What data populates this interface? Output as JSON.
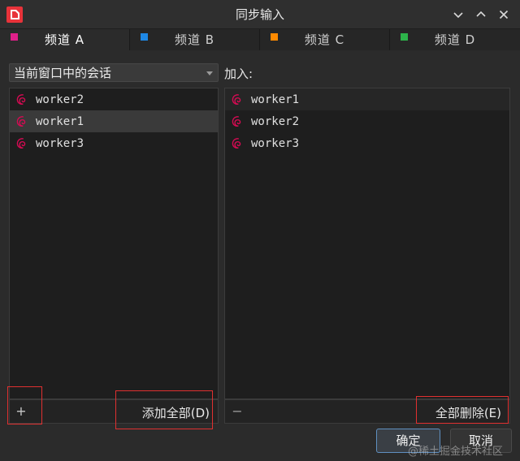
{
  "window": {
    "title": "同步输入",
    "icon": "app-logo-icon"
  },
  "tabs": [
    {
      "label": "频道 A",
      "color": "#e0208a",
      "active": true
    },
    {
      "label": "频道 B",
      "color": "#1e88e5",
      "active": false
    },
    {
      "label": "频道 C",
      "color": "#ff8a00",
      "active": false
    },
    {
      "label": "频道 D",
      "color": "#2db34a",
      "active": false
    }
  ],
  "left_panel": {
    "source_select": "当前窗口中的会话",
    "items": [
      {
        "label": "worker2",
        "icon": "debian-swirl-icon",
        "selected": false
      },
      {
        "label": "worker1",
        "icon": "debian-swirl-icon",
        "selected": true
      },
      {
        "label": "worker3",
        "icon": "debian-swirl-icon",
        "selected": false
      }
    ],
    "add_button": "+",
    "add_all_button": "添加全部(D)"
  },
  "right_panel": {
    "label": "加入:",
    "items": [
      {
        "label": "worker1",
        "icon": "debian-swirl-icon"
      },
      {
        "label": "worker2",
        "icon": "debian-swirl-icon"
      },
      {
        "label": "worker3",
        "icon": "debian-swirl-icon"
      }
    ],
    "remove_button": "−",
    "delete_all_button": "全部删除(E)"
  },
  "dialog_buttons": {
    "ok": "确定",
    "cancel": "取消"
  },
  "watermark": "@稀土掘金技术社区",
  "colors": {
    "annotation": "#e03030",
    "debian": "#d70a53",
    "focus": "#5f8fc0"
  }
}
